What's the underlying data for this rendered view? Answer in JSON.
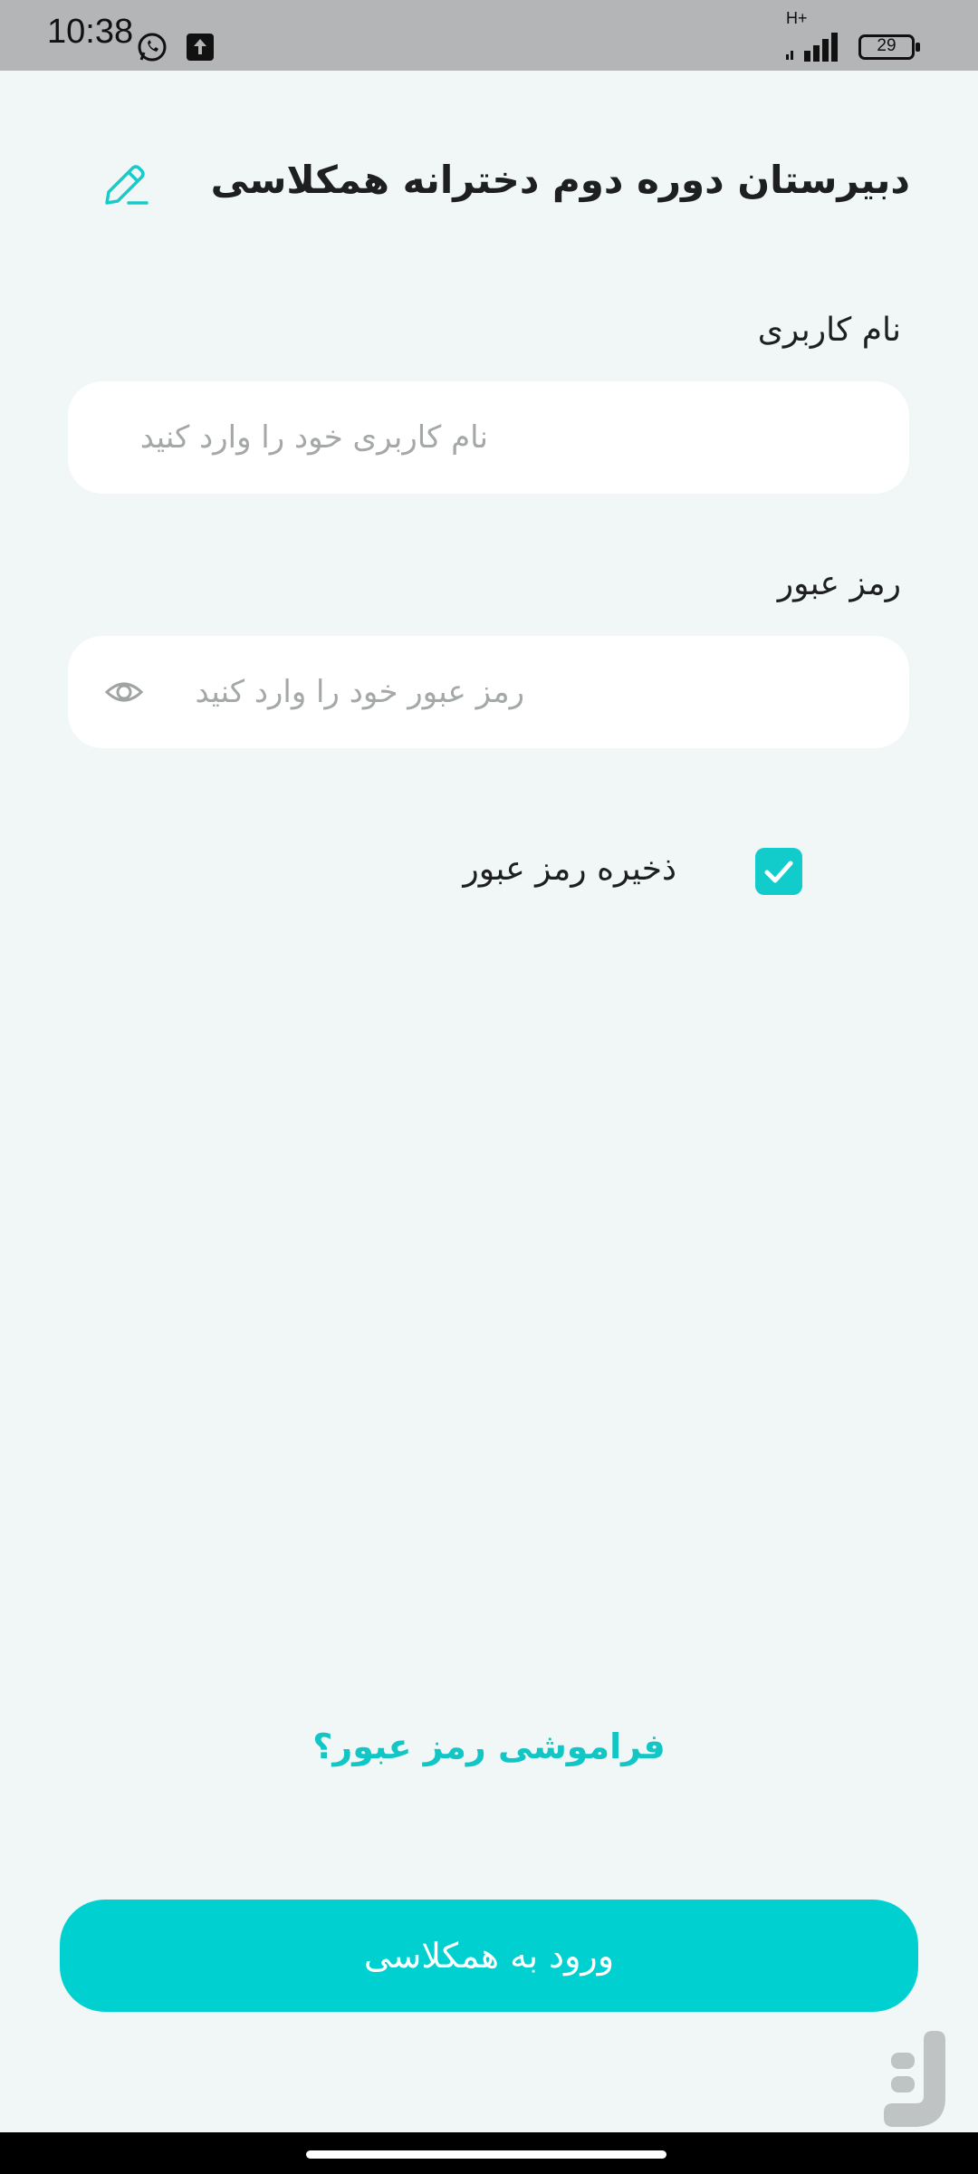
{
  "status_bar": {
    "time": "10:38",
    "network": "H+",
    "battery": "29",
    "icons": [
      "whatsapp-icon",
      "upload-icon",
      "signal-icon",
      "battery-icon"
    ]
  },
  "header": {
    "title": "دبیرستان دوره دوم دخترانه همکلاسی",
    "edit_icon": "edit-icon"
  },
  "form": {
    "username_label": "نام کاربری",
    "username_placeholder": "نام کاربری خود را وارد کنید",
    "username_value": "",
    "password_label": "رمز عبور",
    "password_placeholder": "رمز عبور خود را وارد کنید",
    "password_value": "",
    "remember_label": "ذخیره رمز عبور",
    "remember_checked": true
  },
  "forgot_link": "فراموشی رمز عبور؟",
  "login_button": "ورود به همکلاسی",
  "colors": {
    "accent": "#00d1d0",
    "background": "#f1f6f6",
    "status_bar": "#b3b5b6"
  }
}
